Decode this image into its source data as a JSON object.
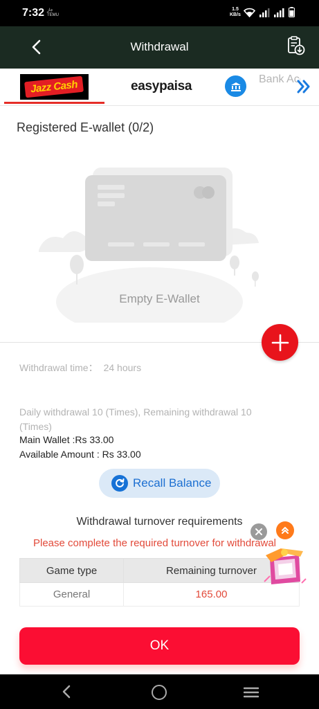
{
  "status_bar": {
    "time": "7:32",
    "notification_lines": [
      "جاز",
      "TEMU"
    ],
    "speed_value": "1.5",
    "speed_unit": "KB/s"
  },
  "header": {
    "title": "Withdrawal"
  },
  "tabs": {
    "jazzcash_label": "Jazz Cash",
    "easypaisa_label": "easypaisa",
    "bank_label": "Bank Account"
  },
  "wallet": {
    "section_title": "Registered E-wallet (0/2)",
    "empty_text": "Empty E-Wallet"
  },
  "info": {
    "withdrawal_time_label": "Withdrawal time：",
    "withdrawal_time_value": "24 hours",
    "daily_limit": "Daily withdrawal 10 (Times), Remaining withdrawal 10 (Times)",
    "main_wallet": "Main Wallet :Rs 33.00",
    "available_amount": "Available Amount : Rs 33.00"
  },
  "recall": {
    "label": "Recall Balance"
  },
  "turnover": {
    "title": "Withdrawal turnover requirements",
    "warning": "Please complete the required turnover for withdrawal",
    "columns": [
      "Game type",
      "Remaining turnover"
    ],
    "rows": [
      {
        "game_type": "General",
        "remaining": "165.00"
      }
    ]
  },
  "ok_button": {
    "label": "OK"
  },
  "colors": {
    "header_bg": "#1b2b22",
    "accent_red": "#fb0e33",
    "link_blue": "#1c6fd1",
    "warning_red": "#e24a3a"
  },
  "icons": [
    "back-arrow-icon",
    "withdrawal-record-icon",
    "bank-icon",
    "double-chevron-right-icon",
    "plus-icon",
    "refresh-icon",
    "close-icon",
    "chevron-up-icon",
    "gift-icon"
  ]
}
